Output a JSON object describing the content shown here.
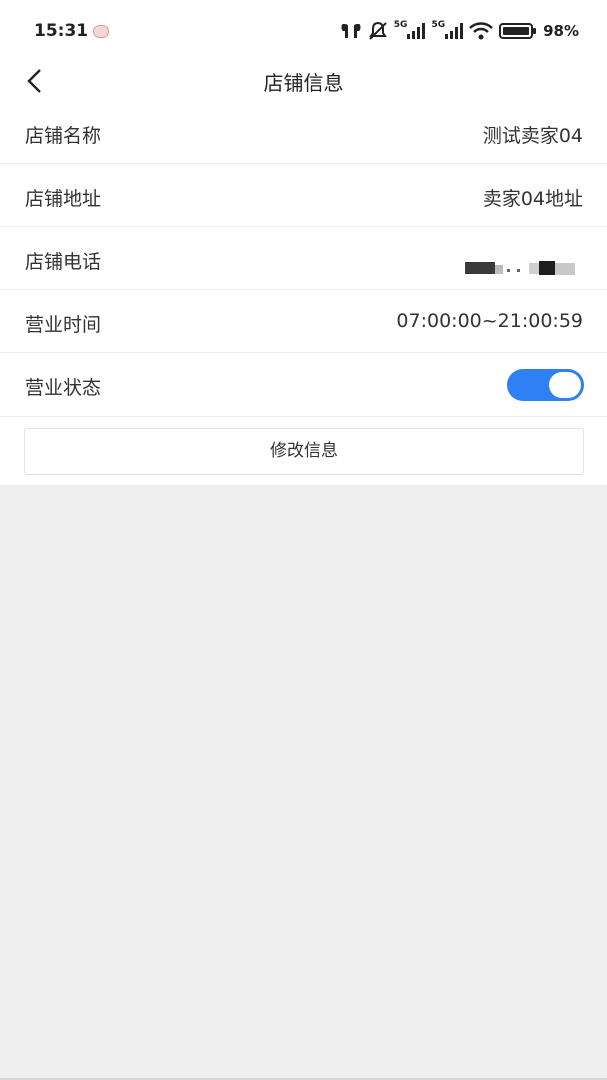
{
  "status_bar": {
    "time": "15:31",
    "net1": "5G",
    "net2": "5G",
    "battery": "98%"
  },
  "header": {
    "title": "店铺信息"
  },
  "rows": [
    {
      "label": "店铺名称",
      "value": "测试卖家04"
    },
    {
      "label": "店铺地址",
      "value": "卖家04地址"
    },
    {
      "label": "店铺电话",
      "value": ""
    },
    {
      "label": "营业时间",
      "value": "07:00:00~21:00:59"
    },
    {
      "label": "营业状态",
      "value": ""
    }
  ],
  "toggle": {
    "on": true,
    "accent": "#2f7ff5"
  },
  "actions": {
    "edit_label": "修改信息"
  }
}
